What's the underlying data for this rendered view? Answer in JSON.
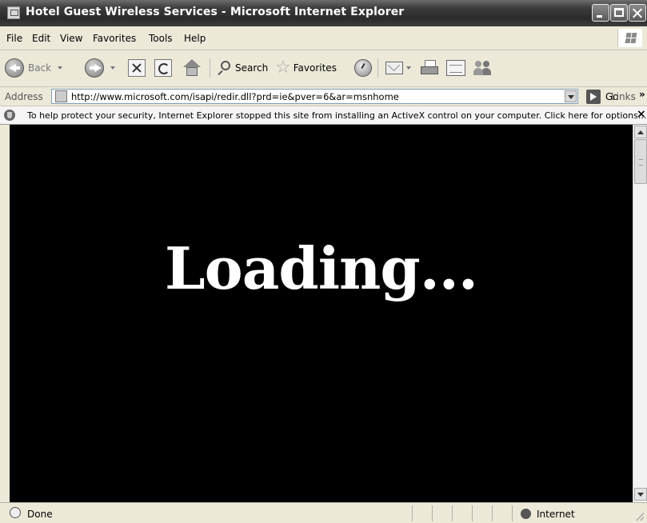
{
  "window": {
    "title": "Hotel Guest Wireless Services - Microsoft Internet Explorer"
  },
  "menu": {
    "items": [
      "File",
      "Edit",
      "View",
      "Favorites",
      "Tools",
      "Help"
    ]
  },
  "toolbar": {
    "back_label": "Back",
    "search_label": "Search",
    "favorites_label": "Favorites"
  },
  "address": {
    "label": "Address",
    "url": "http://www.microsoft.com/isapi/redir.dll?prd=ie&pver=6&ar=msnhome",
    "go_label": "Go",
    "links_label": "Links",
    "links_more": "»"
  },
  "infobar": {
    "message": "To help protect your security, Internet Explorer stopped this site from installing an ActiveX control on your computer. Click here for options...",
    "close": "×"
  },
  "content": {
    "loading_text": "Loading..."
  },
  "status": {
    "text": "Done",
    "zone": "Internet"
  },
  "icons": {
    "app": "ie-page-icon",
    "back": "back-arrow-icon",
    "forward": "forward-arrow-icon",
    "stop": "stop-icon",
    "refresh": "refresh-icon",
    "home": "home-icon",
    "search": "search-icon",
    "favorites": "star-icon",
    "history": "history-icon",
    "mail": "mail-icon",
    "print": "print-icon",
    "edit": "edit-icon",
    "messenger": "messenger-icon",
    "go": "go-arrow-icon",
    "infobar": "shield-icon",
    "zone": "globe-icon"
  }
}
